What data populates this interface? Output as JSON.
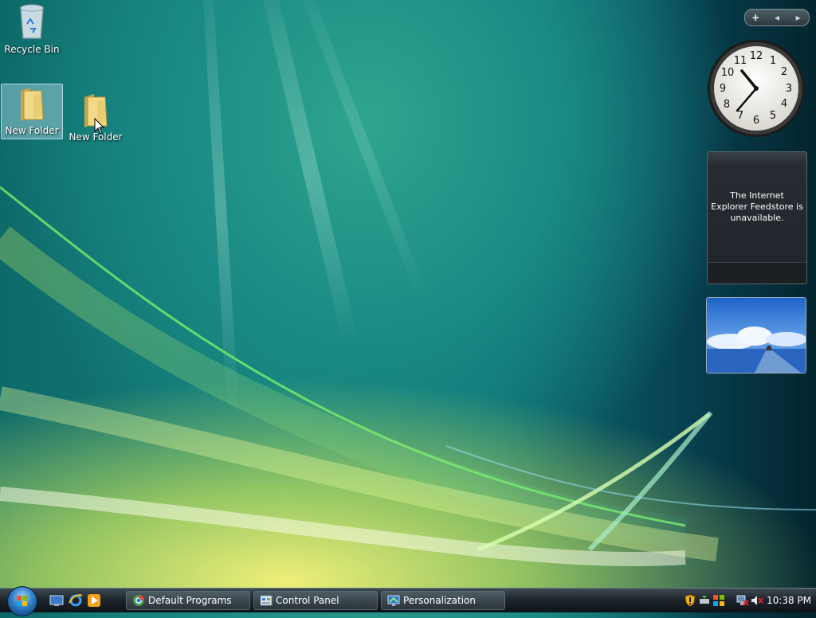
{
  "desktop": {
    "icons": [
      {
        "label": "Recycle Bin",
        "icon": "recycle-bin-icon"
      },
      {
        "label": "New Folder",
        "icon": "folder-icon",
        "selected": true
      },
      {
        "label": "New Folder",
        "icon": "folder-icon",
        "selected": false
      }
    ]
  },
  "sidebar": {
    "toolbar": {
      "add_label": "+",
      "prev_label": "◂",
      "next_label": "▸"
    },
    "feed": {
      "message": "The Internet Explorer Feedstore is unavailable."
    }
  },
  "taskbar": {
    "tasks": [
      {
        "label": "Default Programs",
        "icon": "default-programs-icon"
      },
      {
        "label": "Control Panel",
        "icon": "control-panel-icon"
      },
      {
        "label": "Personalization",
        "icon": "personalization-icon"
      }
    ],
    "tray": {
      "time": "10:38 PM"
    }
  },
  "colors": {
    "taskbar": "#1e262c",
    "selection": "#b4dceb"
  }
}
